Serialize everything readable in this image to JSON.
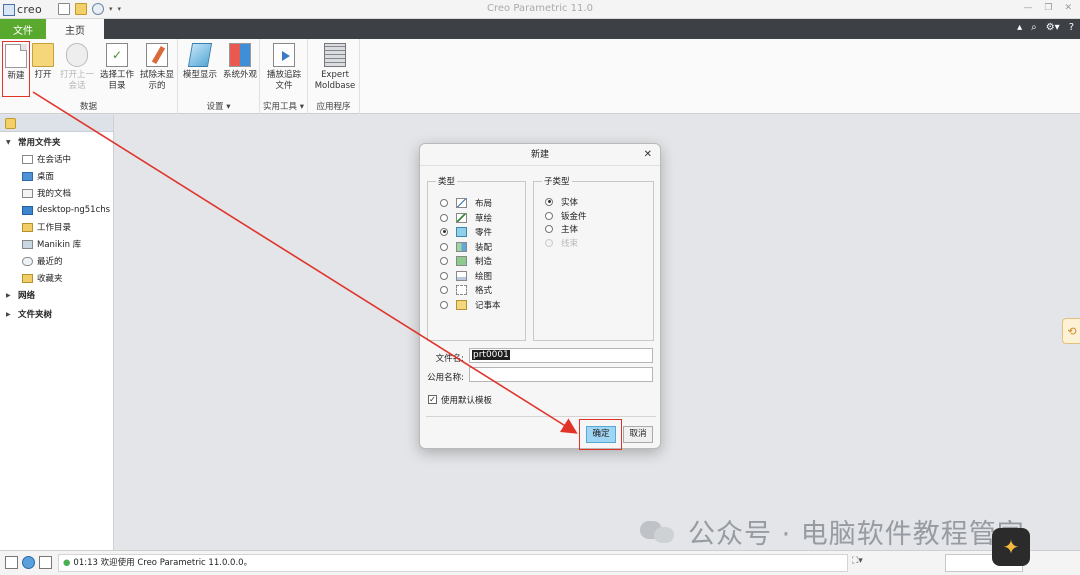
{
  "titlebar": {
    "logo_text": "creo",
    "window_title": "Creo Parametric 11.0",
    "controls": [
      "—",
      "❐",
      "✕"
    ]
  },
  "tabs": {
    "file": "文件",
    "home": "主页"
  },
  "ribbon": {
    "groups": {
      "data": {
        "label": "数据",
        "buttons": {
          "new": "新建",
          "open": "打开",
          "open_prev": "打开上一会话",
          "select_dir": "选择工作目录",
          "erase": "拭除未显示的"
        }
      },
      "settings": {
        "label": "设置",
        "buttons": {
          "model_display": "模型显示",
          "system_appearance": "系统外观"
        }
      },
      "utilities": {
        "label": "实用工具",
        "buttons": {
          "play_trail": "播放追踪文件"
        }
      },
      "apps": {
        "label": "应用程序",
        "buttons": {
          "expert_moldbase": "Expert Moldbase"
        }
      }
    }
  },
  "navigator": {
    "common_folders": "常用文件夹",
    "items": [
      "在会话中",
      "桌面",
      "我的文档",
      "desktop-ng51chs",
      "工作目录",
      "Manikin 库",
      "最近的",
      "收藏夹"
    ],
    "network": "网络",
    "folder_tree": "文件夹树"
  },
  "dialog": {
    "title": "新建",
    "type_legend": "类型",
    "types": [
      {
        "label": "布局",
        "selected": false,
        "icon": "layout-icon"
      },
      {
        "label": "草绘",
        "selected": false,
        "icon": "sketch-icon"
      },
      {
        "label": "零件",
        "selected": true,
        "icon": "part-icon"
      },
      {
        "label": "装配",
        "selected": false,
        "icon": "assembly-icon"
      },
      {
        "label": "制造",
        "selected": false,
        "icon": "manufacturing-icon"
      },
      {
        "label": "绘图",
        "selected": false,
        "icon": "drawing-icon"
      },
      {
        "label": "格式",
        "selected": false,
        "icon": "format-icon"
      },
      {
        "label": "记事本",
        "selected": false,
        "icon": "notebook-icon"
      }
    ],
    "subtype_legend": "子类型",
    "subtypes": [
      {
        "label": "实体",
        "selected": true,
        "enabled": true
      },
      {
        "label": "钣金件",
        "selected": false,
        "enabled": true
      },
      {
        "label": "主体",
        "selected": false,
        "enabled": true
      },
      {
        "label": "线束",
        "selected": false,
        "enabled": false
      }
    ],
    "file_name_label": "文件名:",
    "file_name_value": "prt0001",
    "common_name_label": "公用名称:",
    "common_name_value": "",
    "use_default_template_label": "使用默认模板",
    "use_default_template_checked": true,
    "ok_label": "确定",
    "cancel_label": "取消"
  },
  "statusbar": {
    "message": "01:13 欢迎使用 Creo Parametric 11.0.0.0。"
  },
  "watermark": {
    "text": "公众号 · 电脑软件教程管家"
  },
  "colors": {
    "file_tab": "#5aa92f",
    "tab_bar": "#3d4045",
    "highlight": "#e0342b",
    "ok_button": "#9fd6f3"
  }
}
